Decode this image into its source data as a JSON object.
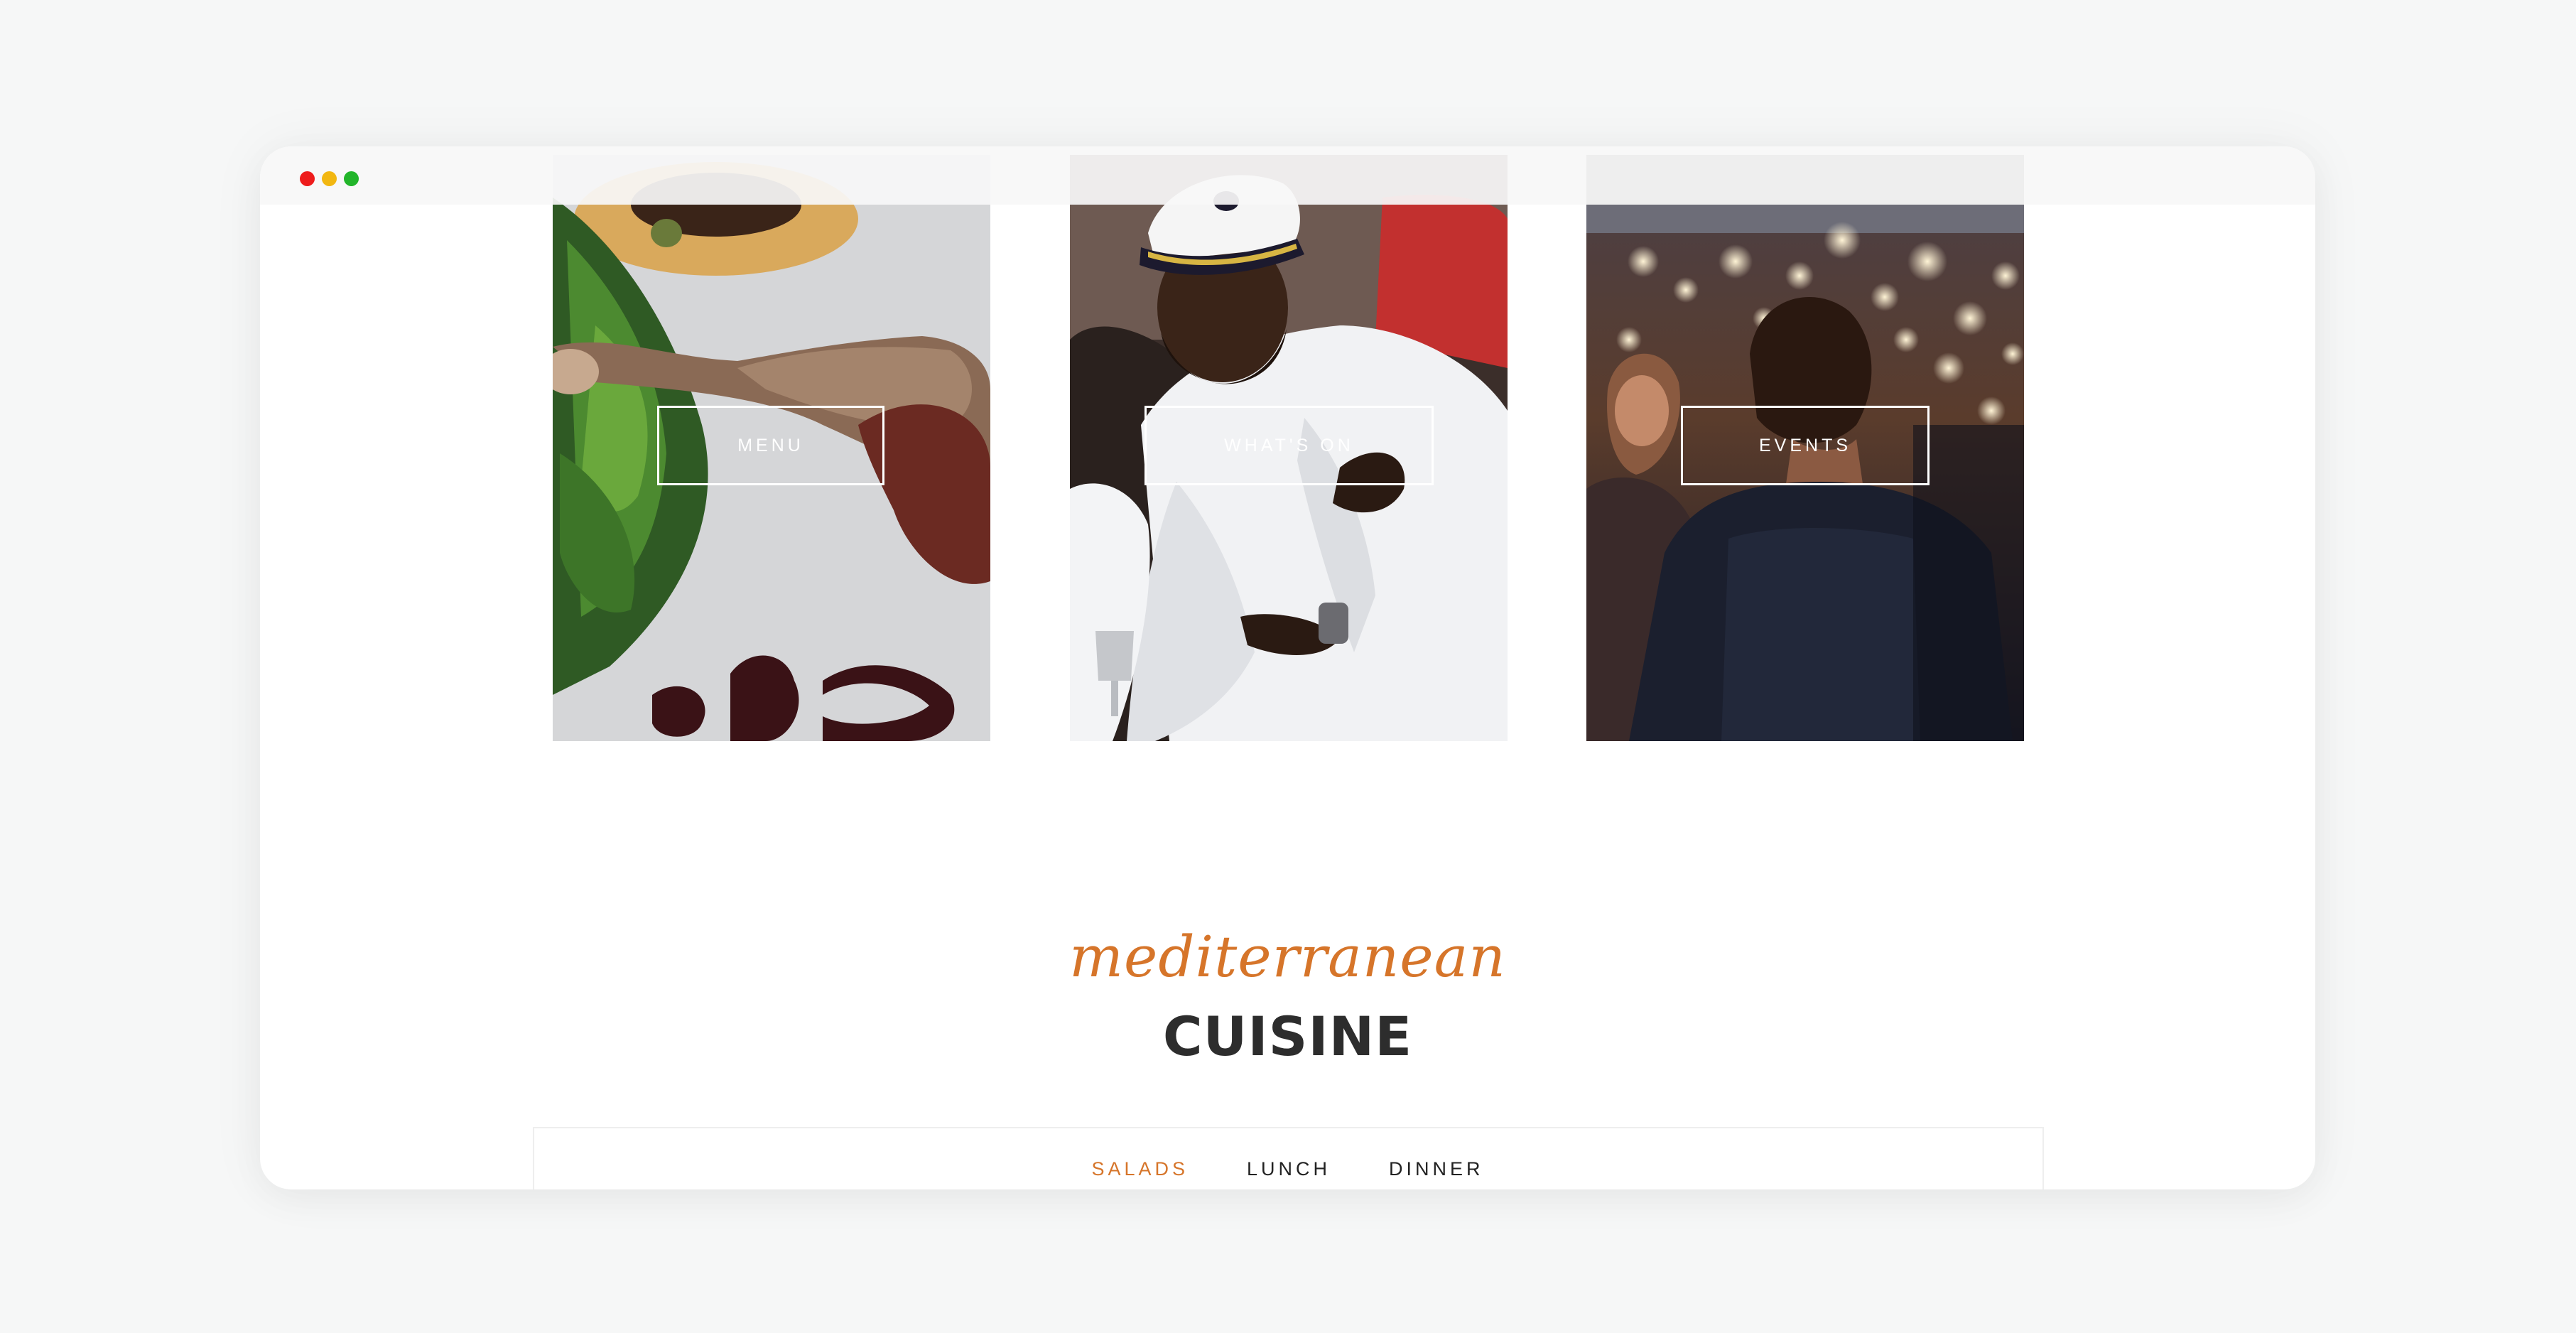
{
  "window": {
    "controls": [
      "close",
      "minimize",
      "maximize"
    ]
  },
  "cards": {
    "menu": {
      "label": "MENU",
      "image": "food-plate-photo"
    },
    "whats_on": {
      "label": "WHAT'S ON",
      "image": "captain-hat-man-photo"
    },
    "events": {
      "label": "EVENTS",
      "image": "party-crowd-photo"
    }
  },
  "section": {
    "script_title": "mediterranean",
    "title": "CUISINE"
  },
  "tabs": {
    "items": [
      {
        "label": "SALADS",
        "active": true
      },
      {
        "label": "LUNCH",
        "active": false
      },
      {
        "label": "DINNER",
        "active": false
      }
    ]
  },
  "colors": {
    "accent": "#d6752a",
    "heading": "#2d2d2d",
    "background": "#f6f7f7"
  }
}
